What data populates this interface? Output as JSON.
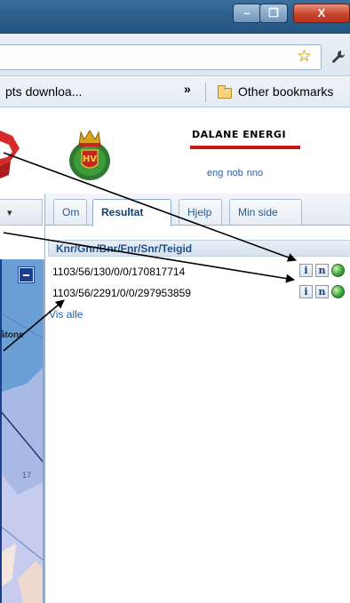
{
  "browser": {
    "window_controls": {
      "minimize": "–",
      "maximize": "❐",
      "close": "X"
    },
    "bookmarks": {
      "truncated_item": "pts downloa...",
      "overflow_chevron": "»",
      "other_bookmarks": "Other bookmarks"
    },
    "icons": {
      "star": "☆",
      "wrench": "🔧"
    }
  },
  "header": {
    "brand": "DALANE ENERGI",
    "brand_color": "#c41a1a",
    "emblem_text": "HV",
    "languages": [
      "eng",
      "nob",
      "nno"
    ]
  },
  "left_panel": {
    "dropdown_arrow": "▾",
    "map_labels": {
      "place": "åtone",
      "number": "17"
    }
  },
  "tabs": [
    {
      "label": "Om"
    },
    {
      "label": "Resultat",
      "active": true
    },
    {
      "label": "Hjelp"
    },
    {
      "label": "Min side"
    }
  ],
  "results": {
    "column_header": "Knr/Gnr/Bnr/Fnr/Snr/Teigid",
    "rows": [
      {
        "id": "1103/56/130/0/0/170817714",
        "info_icon": "i",
        "n_icon": "n"
      },
      {
        "id": "1103/56/2291/0/0/297953859",
        "info_icon": "i",
        "n_icon": "n"
      }
    ],
    "show_all": "Vis alle"
  }
}
